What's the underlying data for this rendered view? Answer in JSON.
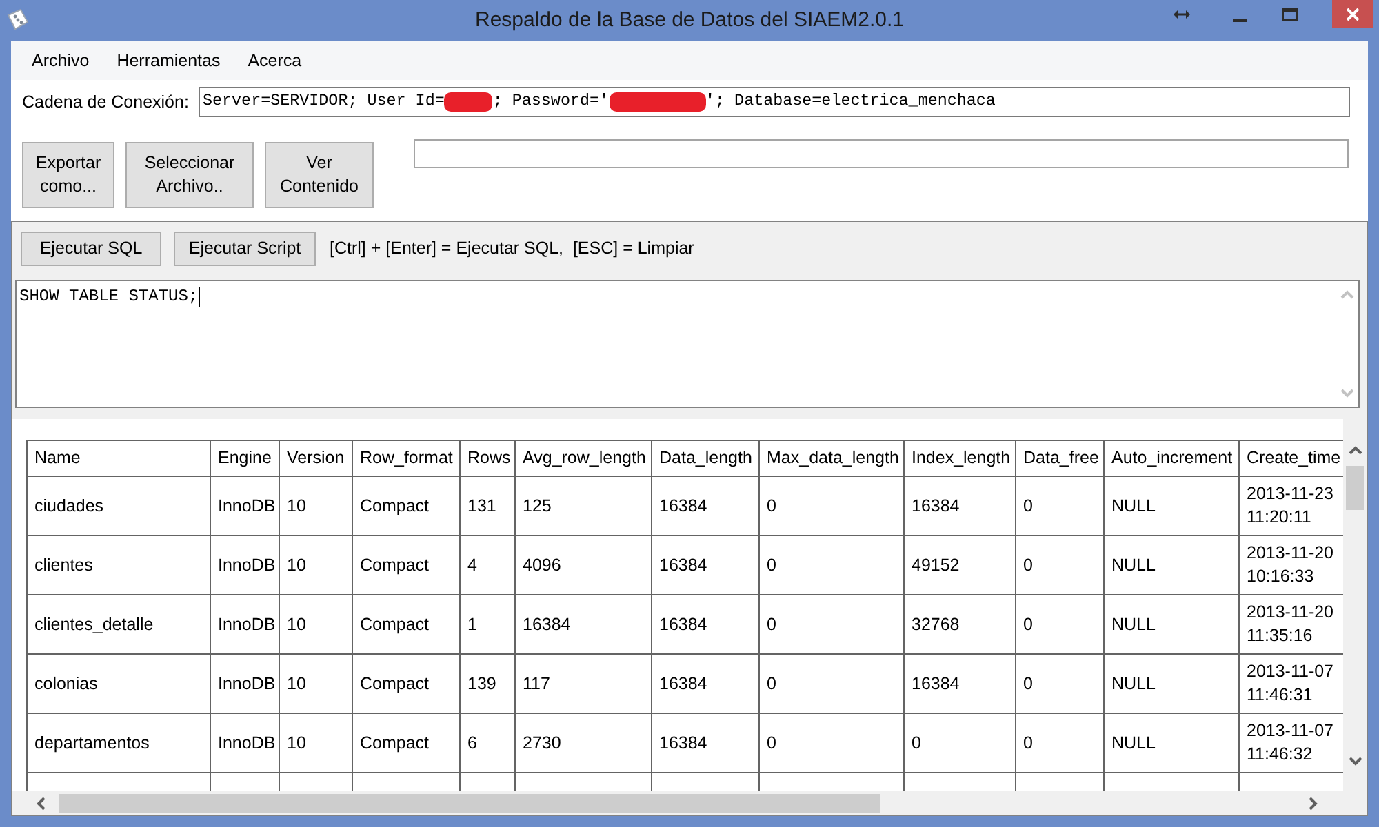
{
  "window": {
    "title": "Respaldo de la Base de Datos del SIAEM2.0.1"
  },
  "menu": [
    "Archivo",
    "Herramientas",
    "Acerca"
  ],
  "connection": {
    "label": "Cadena de Conexión:",
    "value": [
      {
        "kind": "text",
        "text": "Server=SERVIDOR; User Id="
      },
      {
        "kind": "redacted"
      },
      {
        "kind": "text",
        "text": "; Password='"
      },
      {
        "kind": "redacted"
      },
      {
        "kind": "text",
        "text": "'; Database=electrica_menchaca"
      }
    ]
  },
  "actions": [
    "Exportar como...",
    "Seleccionar Archivo..",
    "Ver Contenido"
  ],
  "sql_panel": {
    "buttons": [
      "Ejecutar SQL",
      "Ejecutar Script"
    ],
    "hint": "[Ctrl] + [Enter] = Ejecutar SQL,  [ESC] = Limpiar",
    "query": "SHOW TABLE STATUS;"
  },
  "table": {
    "columns": [
      "Name",
      "Engine",
      "Version",
      "Row_format",
      "Rows",
      "Avg_row_length",
      "Data_length",
      "Max_data_length",
      "Index_length",
      "Data_free",
      "Auto_increment",
      "Create_time"
    ],
    "rows": [
      [
        "ciudades",
        "InnoDB",
        "10",
        "Compact",
        "131",
        "125",
        "16384",
        "0",
        "16384",
        "0",
        "NULL",
        "2013-11-23 11:20:11"
      ],
      [
        "clientes",
        "InnoDB",
        "10",
        "Compact",
        "4",
        "4096",
        "16384",
        "0",
        "49152",
        "0",
        "NULL",
        "2013-11-20 10:16:33"
      ],
      [
        "clientes_detalle",
        "InnoDB",
        "10",
        "Compact",
        "1",
        "16384",
        "16384",
        "0",
        "32768",
        "0",
        "NULL",
        "2013-11-20 11:35:16"
      ],
      [
        "colonias",
        "InnoDB",
        "10",
        "Compact",
        "139",
        "117",
        "16384",
        "0",
        "16384",
        "0",
        "NULL",
        "2013-11-07 11:46:31"
      ],
      [
        "departamentos",
        "InnoDB",
        "10",
        "Compact",
        "6",
        "2730",
        "16384",
        "0",
        "0",
        "0",
        "NULL",
        "2013-11-07 11:46:32"
      ]
    ]
  }
}
